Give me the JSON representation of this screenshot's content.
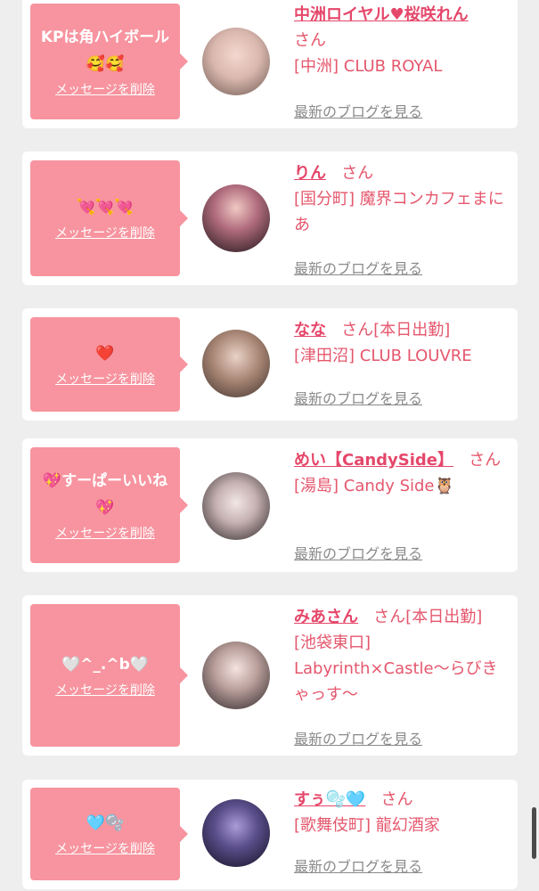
{
  "delete_label": "メッセージを削除",
  "blog_label": "最新のブログを見る",
  "colors": {
    "bubble": "#f7949f",
    "name": "#e5476a",
    "text": "#e5576d",
    "blog": "#8a8a8a",
    "background": "#eeeeee"
  },
  "entries": [
    {
      "message": "KPは角ハイボール🥰🥰",
      "name": "中洲ロイヤル♥桜咲れん",
      "san": "さん",
      "status": "",
      "shop": "[中洲] CLUB ROYAL",
      "avatar_icon": "profile-photo"
    },
    {
      "message": "💘💘💘",
      "name": "りん",
      "san": "さん",
      "status": "",
      "shop": "[国分町] 魔界コンカフェまにあ",
      "avatar_icon": "profile-photo"
    },
    {
      "message": "❤️",
      "name": "なな",
      "san": "さん",
      "status": "[本日出勤]",
      "shop": "[津田沼] CLUB LOUVRE",
      "avatar_icon": "profile-photo"
    },
    {
      "message": "💖すーぱーいいね💖",
      "name": "めい【CandySide】",
      "san": "さん",
      "status": "",
      "shop": "[湯島] Candy Side🦉",
      "avatar_icon": "profile-photo"
    },
    {
      "message": "🤍^_.^b🤍",
      "name": "みあさん",
      "san": "さん",
      "status": "[本日出勤]",
      "shop": "[池袋東口] Labyrinth×Castle〜らびきゃっす〜",
      "avatar_icon": "profile-photo"
    },
    {
      "message": "🩵🫧",
      "name": "すぅ🫧🩵",
      "san": "さん",
      "status": "",
      "shop": "[歌舞伎町] 龍幻酒家",
      "avatar_icon": "profile-photo"
    }
  ]
}
